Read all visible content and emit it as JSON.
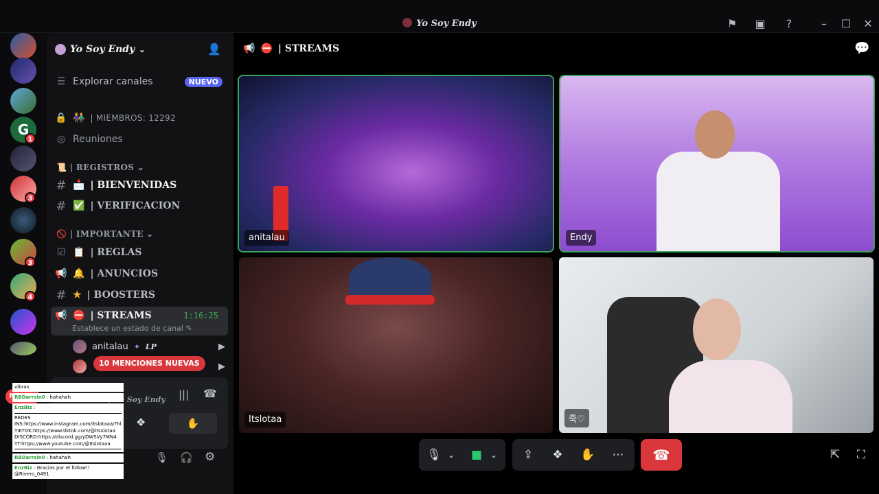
{
  "window": {
    "title": "Yo Soy Endy"
  },
  "guilds": {
    "badges": [
      "1",
      "3",
      "3",
      "4"
    ],
    "nuevo_label": "NUEVO"
  },
  "server": {
    "name": "Yo Soy Endy",
    "explore_label": "Explorar canales",
    "new_badge": "NUEVO",
    "members_label": "| MIEMBROS: 12292",
    "meetings_label": "Reuniones"
  },
  "categories": {
    "registros": "| REGISTROS",
    "importante": "| IMPORTANTE"
  },
  "channels": {
    "bienvenidas": "| BIENVENIDAS",
    "verificacion": "| VERIFICACION",
    "reglas": "| REGLAS",
    "anuncios": "| ANUNCIOS",
    "boosters": "| BOOSTERS",
    "streams": "| STREAMS",
    "streams_timer": "1:16:25",
    "streams_status": "Establece un estado de canal"
  },
  "voice_users": [
    {
      "name": "anitalau",
      "tag": "LP"
    }
  ],
  "mentions_pill": "10 MENCIONES NUEVAS",
  "voice_panel": {
    "channel": "EAMS / Yo Soy Endy"
  },
  "overlay_chat": [
    {
      "text": "vibras"
    },
    {
      "name": "RBDarrsin0",
      "text": ": hahahah"
    },
    {
      "name": "EnzBiz",
      "text": ":"
    },
    {
      "text": "REDES"
    },
    {
      "text": "INS:https://www.instagram.com/itslotaaa/?hl=es"
    },
    {
      "text": "TIKTOK:https://www.tiktok.com/@itsslotaa"
    },
    {
      "text": "DISCORD:https://discord.gg/yDWSVy7MN4"
    },
    {
      "text": "YT:https://www.youtube.com/@Itslotaaa"
    },
    {
      "name": "RBDarrsin0",
      "text": ": hahahah"
    },
    {
      "name": "EnzBiz",
      "text": ": Gracias por el follow!!"
    },
    {
      "text": "@Rivero_0491"
    }
  ],
  "main": {
    "channel_title": "| STREAMS",
    "tiles": [
      {
        "name": "anitalau"
      },
      {
        "name": "Endy"
      },
      {
        "name": "Itslotaa"
      },
      {
        "name": "죽♡"
      }
    ]
  },
  "colors": {
    "accent": "#5865f2",
    "speaking": "#3ba55c",
    "danger": "#da373c",
    "video_on": "#2dc770"
  }
}
